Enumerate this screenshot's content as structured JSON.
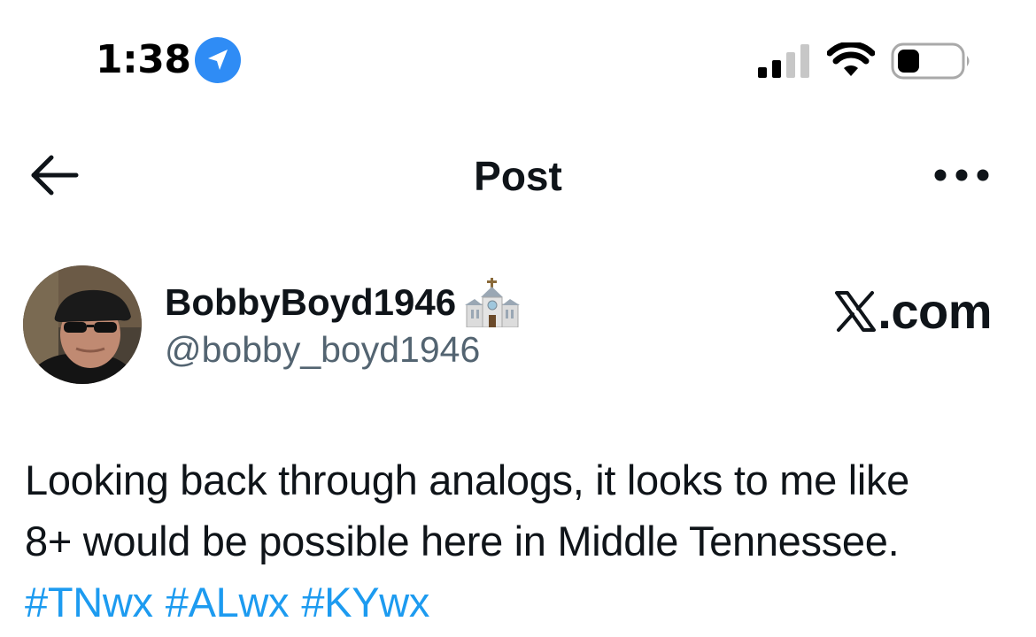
{
  "status_bar": {
    "time": "1:38",
    "location_icon": "location-arrow-icon",
    "signal_icon": "cellular-signal-icon",
    "wifi_icon": "wifi-icon",
    "battery_icon": "battery-icon",
    "signal_bars_active": 2,
    "signal_bars_total": 4,
    "battery_level": 0.35
  },
  "nav": {
    "back_icon": "arrow-left-icon",
    "title": "Post",
    "more_icon": "more-horizontal-icon"
  },
  "post": {
    "author": {
      "display_name": "BobbyBoyd1946",
      "name_emoji_icon": "church-icon",
      "handle": "@bobby_boyd1946"
    },
    "brand": {
      "logo_icon": "x-logo-icon",
      "text": ".com"
    },
    "text_lines": [
      "Looking back through analogs, it looks to me like",
      "8+ would be possible here in Middle Tennessee."
    ],
    "hashtags": [
      "#TNwx",
      "#ALwx",
      "#KYwx"
    ]
  },
  "colors": {
    "text_primary": "#0f1419",
    "text_secondary": "#536471",
    "link": "#1d9bf0",
    "location_badge": "#2f8cf5"
  }
}
